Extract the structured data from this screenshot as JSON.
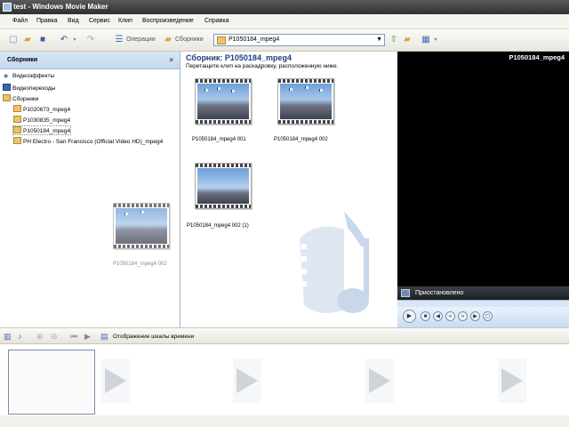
{
  "window": {
    "title": "test - Windows Movie Maker"
  },
  "menu": [
    "Файл",
    "Правка",
    "Вид",
    "Сервис",
    "Клип",
    "Воспроизведение",
    "Справка"
  ],
  "toolbar": {
    "tasks_label": "Операции",
    "collections_label": "Сборники",
    "collection_dropdown": "P1050184_mpeg4"
  },
  "collections_pane": {
    "title": "Сборники",
    "close": "×",
    "items": [
      {
        "label": "Видеоэффекты",
        "level": 0,
        "icon": "star-icon"
      },
      {
        "label": "Видеопереходы",
        "level": 0,
        "icon": "transition-icon"
      },
      {
        "label": "Сборники",
        "level": 0,
        "icon": "folder-icon"
      },
      {
        "label": "P1020673_mpeg4",
        "level": 1,
        "icon": "collection-icon"
      },
      {
        "label": "P1030835_mpeg4",
        "level": 1,
        "icon": "collection-icon"
      },
      {
        "label": "P1050184_mpeg4",
        "level": 1,
        "icon": "collection-icon"
      },
      {
        "label": "PH Electro - San Francisco (Official Video HD)_mpeg4",
        "level": 1,
        "icon": "collection-icon"
      }
    ]
  },
  "content_pane": {
    "title": "Сборник: P1050184_mpeg4",
    "subtitle": "Перетащите клип на раскадровку, расположенную ниже.",
    "clips": [
      {
        "label": "P1050184_mpeg4 001"
      },
      {
        "label": "P1050184_mpeg4 002"
      },
      {
        "label": "P1050184_mpeg4 002 (1)"
      }
    ],
    "drag_ghost_label": "P1050184_mpeg4 002"
  },
  "preview": {
    "title": "P1050184_mpeg4",
    "status": "Приостановлено"
  },
  "storyboard": {
    "view_label": "Отображение шкалы времени"
  },
  "colors": {
    "title_bar": "#3a3a3a",
    "pane_header": "#c3d7ee",
    "content_title": "#1b3f80",
    "preview_bg": "#000000"
  }
}
